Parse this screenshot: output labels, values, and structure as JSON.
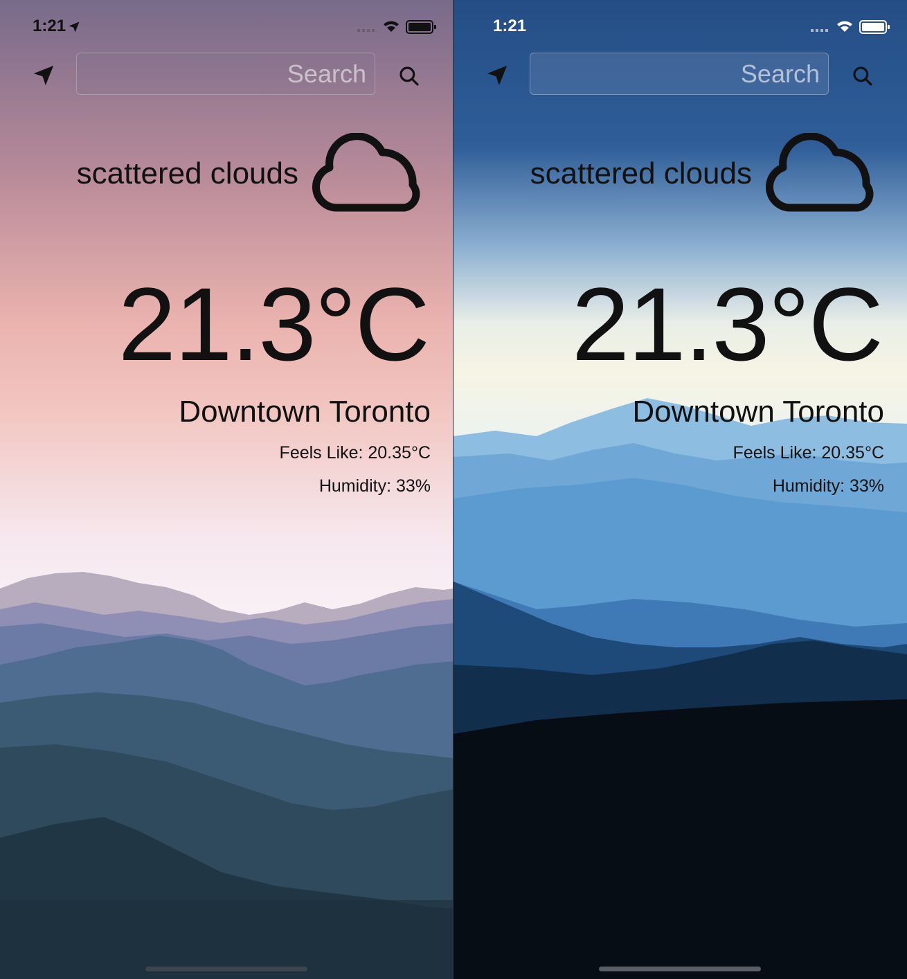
{
  "status_bar": {
    "time": "1:21"
  },
  "search": {
    "placeholder": "Search"
  },
  "weather": {
    "condition": "scattered clouds",
    "temperature": "21.3°C",
    "city": "Downtown Toronto",
    "feels_like": "Feels Like: 20.35°C",
    "humidity": "Humidity: 33%"
  },
  "themes": {
    "light": {
      "sky_top": "#7b6a8c",
      "sky_mid": "#efbcb4",
      "sky_low": "#f8f0f4",
      "text": "#111111"
    },
    "dark": {
      "sky_top": "#244f86",
      "sky_mid": "#f4f3e6",
      "sky_low": "#5a9fd6",
      "text": "#111111"
    }
  },
  "icons": [
    "location-arrow-icon",
    "search-icon",
    "cloud-icon",
    "wifi-icon",
    "battery-icon",
    "signal-icon"
  ]
}
